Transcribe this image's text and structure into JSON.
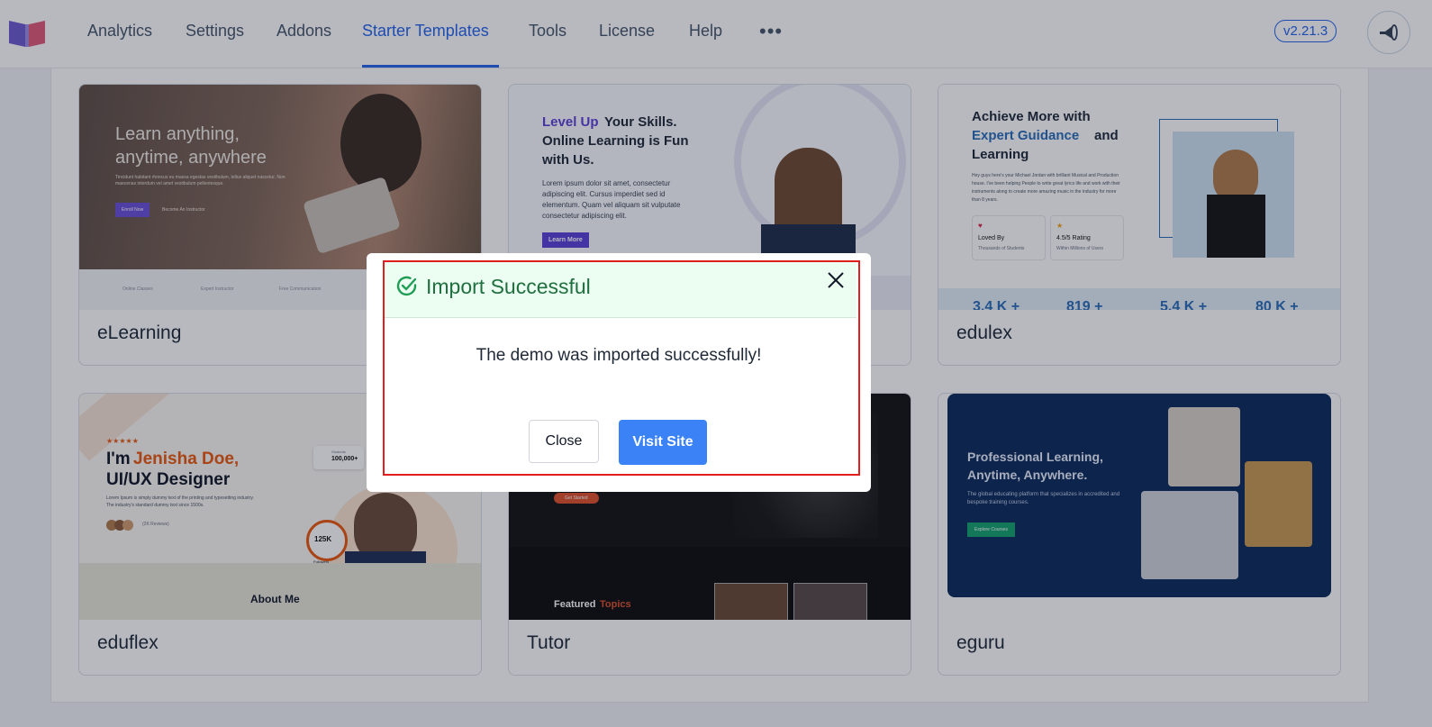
{
  "nav": {
    "items": [
      "Analytics",
      "Settings",
      "Addons",
      "Starter Templates",
      "Tools",
      "License",
      "Help"
    ],
    "more": "•••",
    "version": "v2.21.3"
  },
  "colors": {
    "accent": "#2563eb",
    "success": "#1f6f3f",
    "primary_button": "#3b82f6",
    "highlight_border": "#e11d1d"
  },
  "cards": [
    {
      "name": "eLearning",
      "headline1": "Learn anything,",
      "headline2": "anytime, anywhere",
      "body": "Tincidunt habitant rhoncus eu massa egestas vestibulum, tellus aliquet nascetur. Non maecenas interdum vel amet vestibulum pellentesque.",
      "button": "Enroll Now",
      "link": "Become An Instructor",
      "features": [
        "Online Classes",
        "Expert Instructor",
        "Free Communication"
      ]
    },
    {
      "name": "",
      "accent": "Level Up",
      "headline1": " Your Skills.",
      "headline2": "Online Learning is Fun",
      "headline3": "with Us.",
      "body": "Lorem ipsum dolor sit amet, consectetur adipiscing elit. Cursus imperdiet sed id elementum. Quam vel aliquam sit vulputate consectetur adipiscing elit.",
      "button": "Learn More"
    },
    {
      "name": "edulex",
      "headline1": "Achieve More with",
      "accent": "Expert Guidance",
      "headline2": " and",
      "headline3": "Learning",
      "body": "Hey guys here's your Michael Jordan with brilliant Musical and Production house. I've been helping People to write great lyrics life and work with their instruments along to create more amazing music in the industry for more than 8 years.",
      "badge1": "Loved By",
      "badge1_sub": "Thousands of Students",
      "badge2": "4.5/5 Rating",
      "badge2_sub": "Within Millions of Users",
      "stats": [
        "3.4 K +",
        "819 +",
        "5.4 K +",
        "80 K +"
      ]
    },
    {
      "name": "eduflex",
      "stars": "★★★★★",
      "headline1": "I'm ",
      "accent": "Jenisha Doe,",
      "headline2": "UI/UX Designer",
      "body": "Lorem Ipsum is simply dummy text of the printing and typesetting industry. The industry's standard dummy text since 1500s.",
      "reviews": "(2K Reviews)",
      "stat1": "100,000+",
      "stat1_label": "Students",
      "stat2": "125K",
      "stat2_label": "Followers",
      "section": "About Me"
    },
    {
      "name": "Tutor",
      "button": "Get Started",
      "section_prefix": "Featured ",
      "section_accent": "Topics"
    },
    {
      "name": "eguru",
      "headline1": "Professional Learning,",
      "headline2": "Anytime, Anywhere.",
      "body": "The global educating platform that specializes in accredited and bespoke training courses.",
      "button": "Explore Courses"
    }
  ],
  "modal": {
    "title": "Import Successful",
    "message": "The demo was imported successfully!",
    "close_label": "Close",
    "visit_label": "Visit Site"
  }
}
